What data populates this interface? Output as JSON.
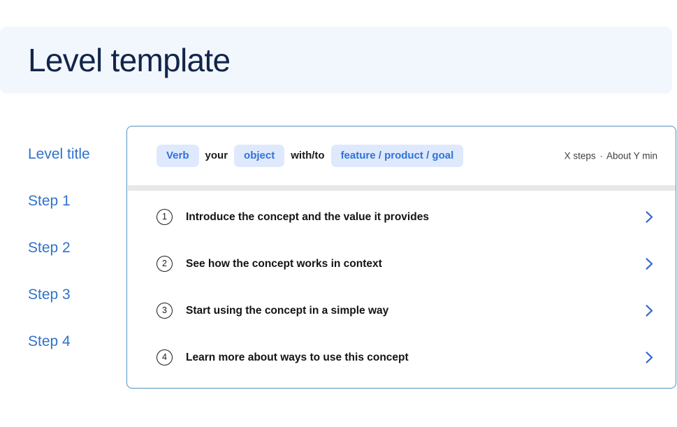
{
  "header": {
    "title": "Level template",
    "background_color": "#f2f7fd",
    "title_color": "#12254a"
  },
  "sidebar": {
    "items": [
      {
        "label": "Level title"
      },
      {
        "label": "Step 1"
      },
      {
        "label": "Step 2"
      },
      {
        "label": "Step 3"
      },
      {
        "label": "Step 4"
      }
    ],
    "link_color": "#3073c9"
  },
  "card": {
    "border_color": "#4e93c4",
    "header": {
      "phrase": [
        {
          "text": "Verb",
          "style": "pill"
        },
        {
          "text": "your",
          "style": "plain"
        },
        {
          "text": "object",
          "style": "pill"
        },
        {
          "text": "with/to",
          "style": "plain"
        },
        {
          "text": "feature / product / goal",
          "style": "pill"
        }
      ],
      "pill_background": "#dfe9fd",
      "pill_text_color": "#3073d8",
      "meta": {
        "steps": "X steps",
        "separator": "·",
        "duration": "About Y min"
      }
    },
    "steps": [
      {
        "number": "1",
        "label": "Introduce the concept and the value it provides",
        "chevron": "chevron-right-icon"
      },
      {
        "number": "2",
        "label": "See how the concept works in context",
        "chevron": "chevron-right-icon"
      },
      {
        "number": "3",
        "label": "Start using the concept in a simple way",
        "chevron": "chevron-right-icon"
      },
      {
        "number": "4",
        "label": "Learn more about ways to use this concept",
        "chevron": "chevron-right-icon"
      }
    ],
    "chevron_color": "#3268d0"
  }
}
